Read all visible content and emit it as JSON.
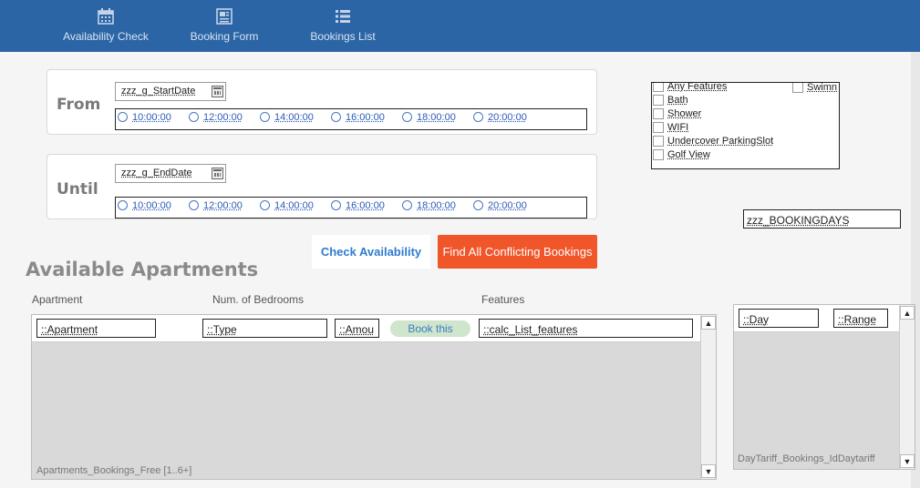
{
  "nav": {
    "items": [
      {
        "label": "Availability Check",
        "icon": "calendar-icon"
      },
      {
        "label": "Booking Form",
        "icon": "form-icon"
      },
      {
        "label": "Bookings List",
        "icon": "list-icon"
      }
    ]
  },
  "from": {
    "label": "From",
    "date": "zzz_g_StartDate",
    "times": [
      "10:00:00",
      "12:00:00",
      "14:00:00",
      "16:00:00",
      "18:00:00",
      "20:00:00"
    ]
  },
  "until": {
    "label": "Until",
    "date": "zzz_g_EndDate",
    "times": [
      "10:00:00",
      "12:00:00",
      "14:00:00",
      "16:00:00",
      "18:00:00",
      "20:00:00"
    ]
  },
  "features": {
    "items": [
      "Any Features",
      "Bath",
      "Shower",
      "WIFI",
      "Undercover ParkingSlot",
      "Golf View",
      "Swimn"
    ]
  },
  "booking_days": "zzz_BOOKINGDAYS",
  "buttons": {
    "check": "Check Availability",
    "find": "Find All Conflicting Bookings"
  },
  "section_title": "Available Apartments",
  "columns": [
    "Apartment",
    "Num. of Bedrooms",
    "Features"
  ],
  "grid": {
    "row": {
      "apartment": "::Apartment",
      "type": "::Type",
      "amount": "::Amou",
      "book": "Book this",
      "features": "::calc_List_features"
    },
    "caption": "Apartments_Bookings_Free [1..6+]"
  },
  "grid2": {
    "row": {
      "day": "::Day",
      "range": "::Range"
    },
    "caption": "DayTariff_Bookings_IdDaytariff"
  },
  "colors": {
    "topbar": "#2b65a6",
    "find_button": "#f0562a",
    "check_button_text": "#2e7bcf",
    "book_button": "#cfe5cc"
  }
}
